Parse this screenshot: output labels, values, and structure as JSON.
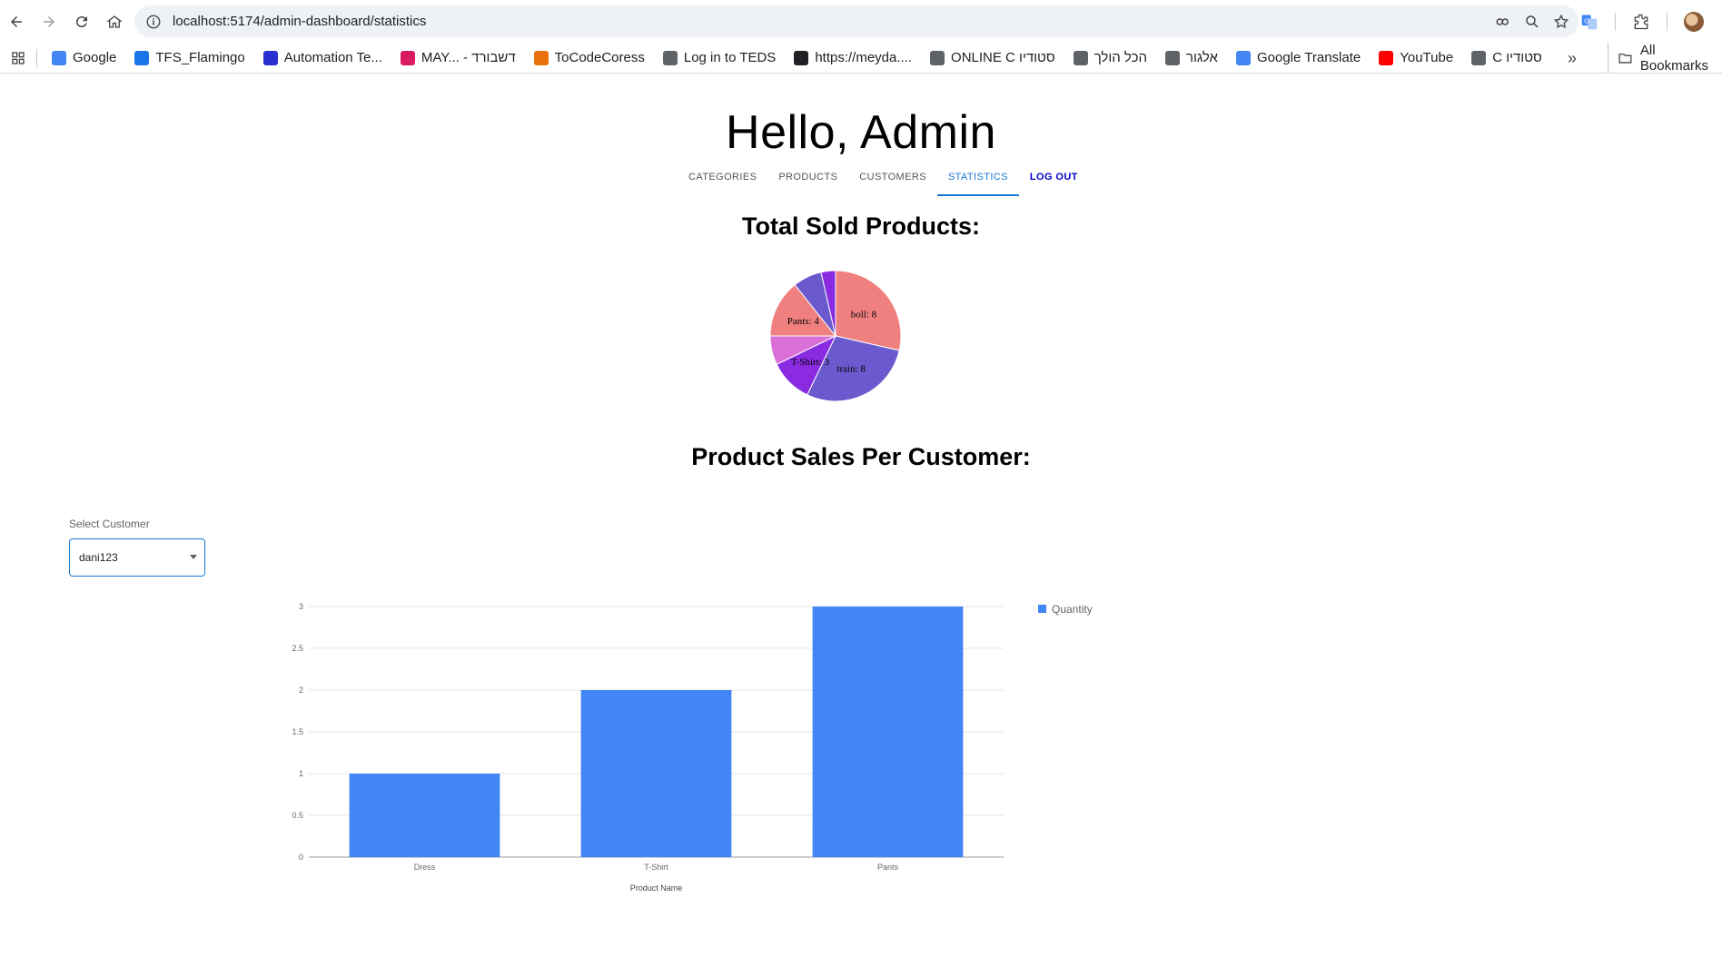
{
  "browser": {
    "url": "localhost:5174/admin-dashboard/statistics",
    "bookmarks": [
      {
        "label": "Google",
        "color": "#4285f4"
      },
      {
        "label": "TFS_Flamingo",
        "color": "#1a73e8"
      },
      {
        "label": "Automation Te...",
        "color": "#2b2ed0"
      },
      {
        "label": "MAY... - דשבורד",
        "color": "#d81b60"
      },
      {
        "label": "ToCodeCoress",
        "color": "#e8710a"
      },
      {
        "label": "Log in to TEDS",
        "color": "#5f6368"
      },
      {
        "label": "https://meyda....",
        "color": "#202124"
      },
      {
        "label": "ONLINE C סטודיו",
        "color": "#5f6368"
      },
      {
        "label": "הכל הולך",
        "color": "#5f6368"
      },
      {
        "label": "אלגור",
        "color": "#5f6368"
      },
      {
        "label": "Google Translate",
        "color": "#4285f4"
      },
      {
        "label": "YouTube",
        "color": "#ff0000"
      },
      {
        "label": "C סטודיו",
        "color": "#5f6368"
      }
    ],
    "all_bookmarks": "All Bookmarks"
  },
  "page": {
    "greeting": "Hello, Admin",
    "tabs": [
      {
        "label": "CATEGORIES"
      },
      {
        "label": "PRODUCTS"
      },
      {
        "label": "CUSTOMERS"
      },
      {
        "label": "STATISTICS"
      },
      {
        "label": "LOG OUT"
      }
    ],
    "active_tab": "STATISTICS",
    "sold_title": "Total Sold Products:",
    "per_customer_title": "Product Sales Per Customer:",
    "select_label": "Select Customer",
    "select_value": "dani123",
    "accent_color": "#1976d2"
  },
  "chart_data": [
    {
      "type": "pie",
      "title": "Total Sold Products:",
      "slices": [
        {
          "label": "boll",
          "value": 8,
          "color": "#f08080",
          "shown_label": "boll: 8"
        },
        {
          "label": "train",
          "value": 8,
          "color": "#6a5acd",
          "shown_label": "train: 8"
        },
        {
          "label": "T-Shirt",
          "value": 3,
          "color": "#8a2be2",
          "shown_label": "T-Shirt: 3"
        },
        {
          "label": "",
          "value": 2,
          "color": "#da70d6",
          "shown_label": ""
        },
        {
          "label": "Pants",
          "value": 4,
          "color": "#f08080",
          "shown_label": "Pants: 4"
        },
        {
          "label": "",
          "value": 2,
          "color": "#6a5acd",
          "shown_label": ""
        },
        {
          "label": "",
          "value": 1,
          "color": "#8a2be2",
          "shown_label": ""
        }
      ]
    },
    {
      "type": "bar",
      "title": "",
      "categories": [
        "Dress",
        "T-Shirt",
        "Pants"
      ],
      "series": [
        {
          "name": "Quantity",
          "values": [
            1,
            2,
            3
          ],
          "color": "#4285f4"
        }
      ],
      "xlabel": "Product Name",
      "ylabel": "",
      "ylim": [
        0,
        3
      ],
      "yticks": [
        "0",
        "0.5",
        "1",
        "1.5",
        "2",
        "2.5",
        "3"
      ],
      "grid": true,
      "legend": "top-right"
    }
  ]
}
